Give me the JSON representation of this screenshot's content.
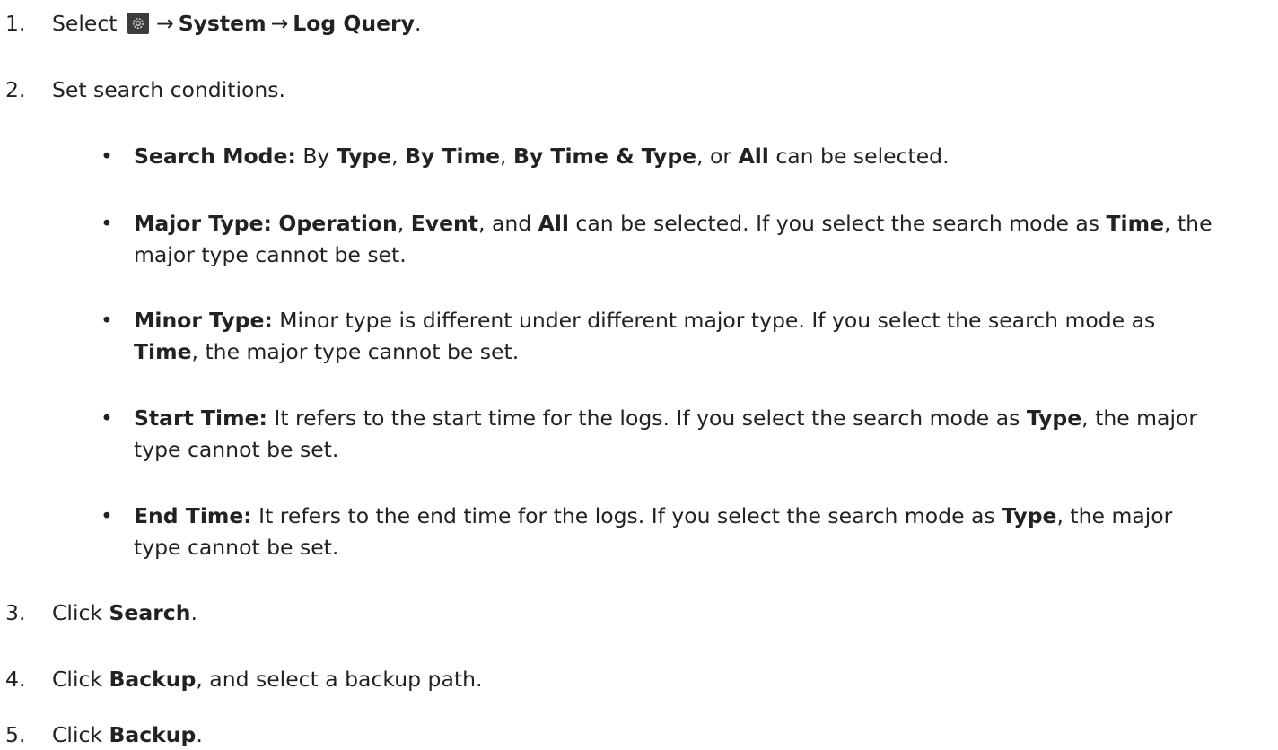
{
  "steps": [
    {
      "number": "1.",
      "select": "Select",
      "icon": "settings-gear-icon",
      "arrow1": "→",
      "menu1": "System",
      "arrow2": "→",
      "menu2": "Log Query",
      "end": "."
    },
    {
      "number": "2.",
      "text": "Set search conditions.",
      "bullets": [
        {
          "label": "Search Mode:",
          "t1": " By ",
          "o1": "Type",
          "t2": ", ",
          "o2": "By Time",
          "t3": ", ",
          "o3": "By Time & Type",
          "t4": ", or ",
          "o4": "All",
          "t5": " can be selected."
        },
        {
          "label": "Major Type:",
          "o1": "Operation",
          "t1": ", ",
          "o2": "Event",
          "t2": ", and ",
          "o3": "All",
          "t3": " can be selected. If you select the search mode as ",
          "o4": "Time",
          "t4": ", the",
          "line2": "major type cannot be set."
        },
        {
          "label": "Minor Type:",
          "t1": " Minor type is different under different major type. If you select the search mode as",
          "o1": "Time",
          "t2": ", the major type cannot be set."
        },
        {
          "label": "Start Time:",
          "t1": " It refers to the start time for the logs. If you select the search mode as ",
          "o1": "Type",
          "t2": ", the major",
          "line2": "type cannot be set."
        },
        {
          "label": "End Time:",
          "t1": " It refers to the end time for the logs. If you select the search mode as ",
          "o1": "Type",
          "t2": ", the major",
          "line2": "type cannot be set."
        }
      ]
    },
    {
      "number": "3.",
      "t1": "Click ",
      "o1": "Search",
      "end": "."
    },
    {
      "number": "4.",
      "t1": "Click ",
      "o1": "Backup",
      "t2": ", and select a backup path."
    },
    {
      "number": "5.",
      "t1": "Click ",
      "o1": "Backup",
      "end": "."
    }
  ]
}
